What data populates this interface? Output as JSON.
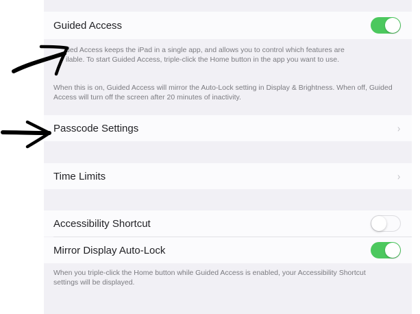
{
  "guided_access": {
    "label": "Guided Access",
    "toggle_on": true,
    "description": "Guided Access keeps the iPad in a single app, and allows you to control which features are available. To start Guided Access, triple-click the Home button in the app you want to use.",
    "description_visible_line1": "ded Access keeps the iPad in a single app, and allows you to control which features are",
    "description_visible_line2": "ilable. To start Guided Access, triple-click the Home button in the app you want to use.",
    "auto_lock_note": "When this is on, Guided Access will mirror the Auto-Lock setting in Display & Brightness. When off, Guided Access will turn off the screen after 20 minutes of inactivity."
  },
  "passcode_settings": {
    "label": "Passcode Settings",
    "chevron": "chevron-right-icon"
  },
  "time_limits": {
    "label": "Time Limits",
    "chevron": "chevron-right-icon"
  },
  "accessibility_shortcut": {
    "label": "Accessibility Shortcut",
    "toggle_on": false
  },
  "mirror_display_auto_lock": {
    "label": "Mirror Display Auto-Lock",
    "toggle_on": true
  },
  "shortcut_note": "When you triple-click the Home button while Guided Access is enabled, your Accessibility Shortcut settings will be displayed.",
  "colors": {
    "toggle_on": "#4cc85e",
    "background": "#f1f0f5",
    "row": "#fbfbfd",
    "footnote": "#7b7b80",
    "annotation_ink": "#000000"
  }
}
